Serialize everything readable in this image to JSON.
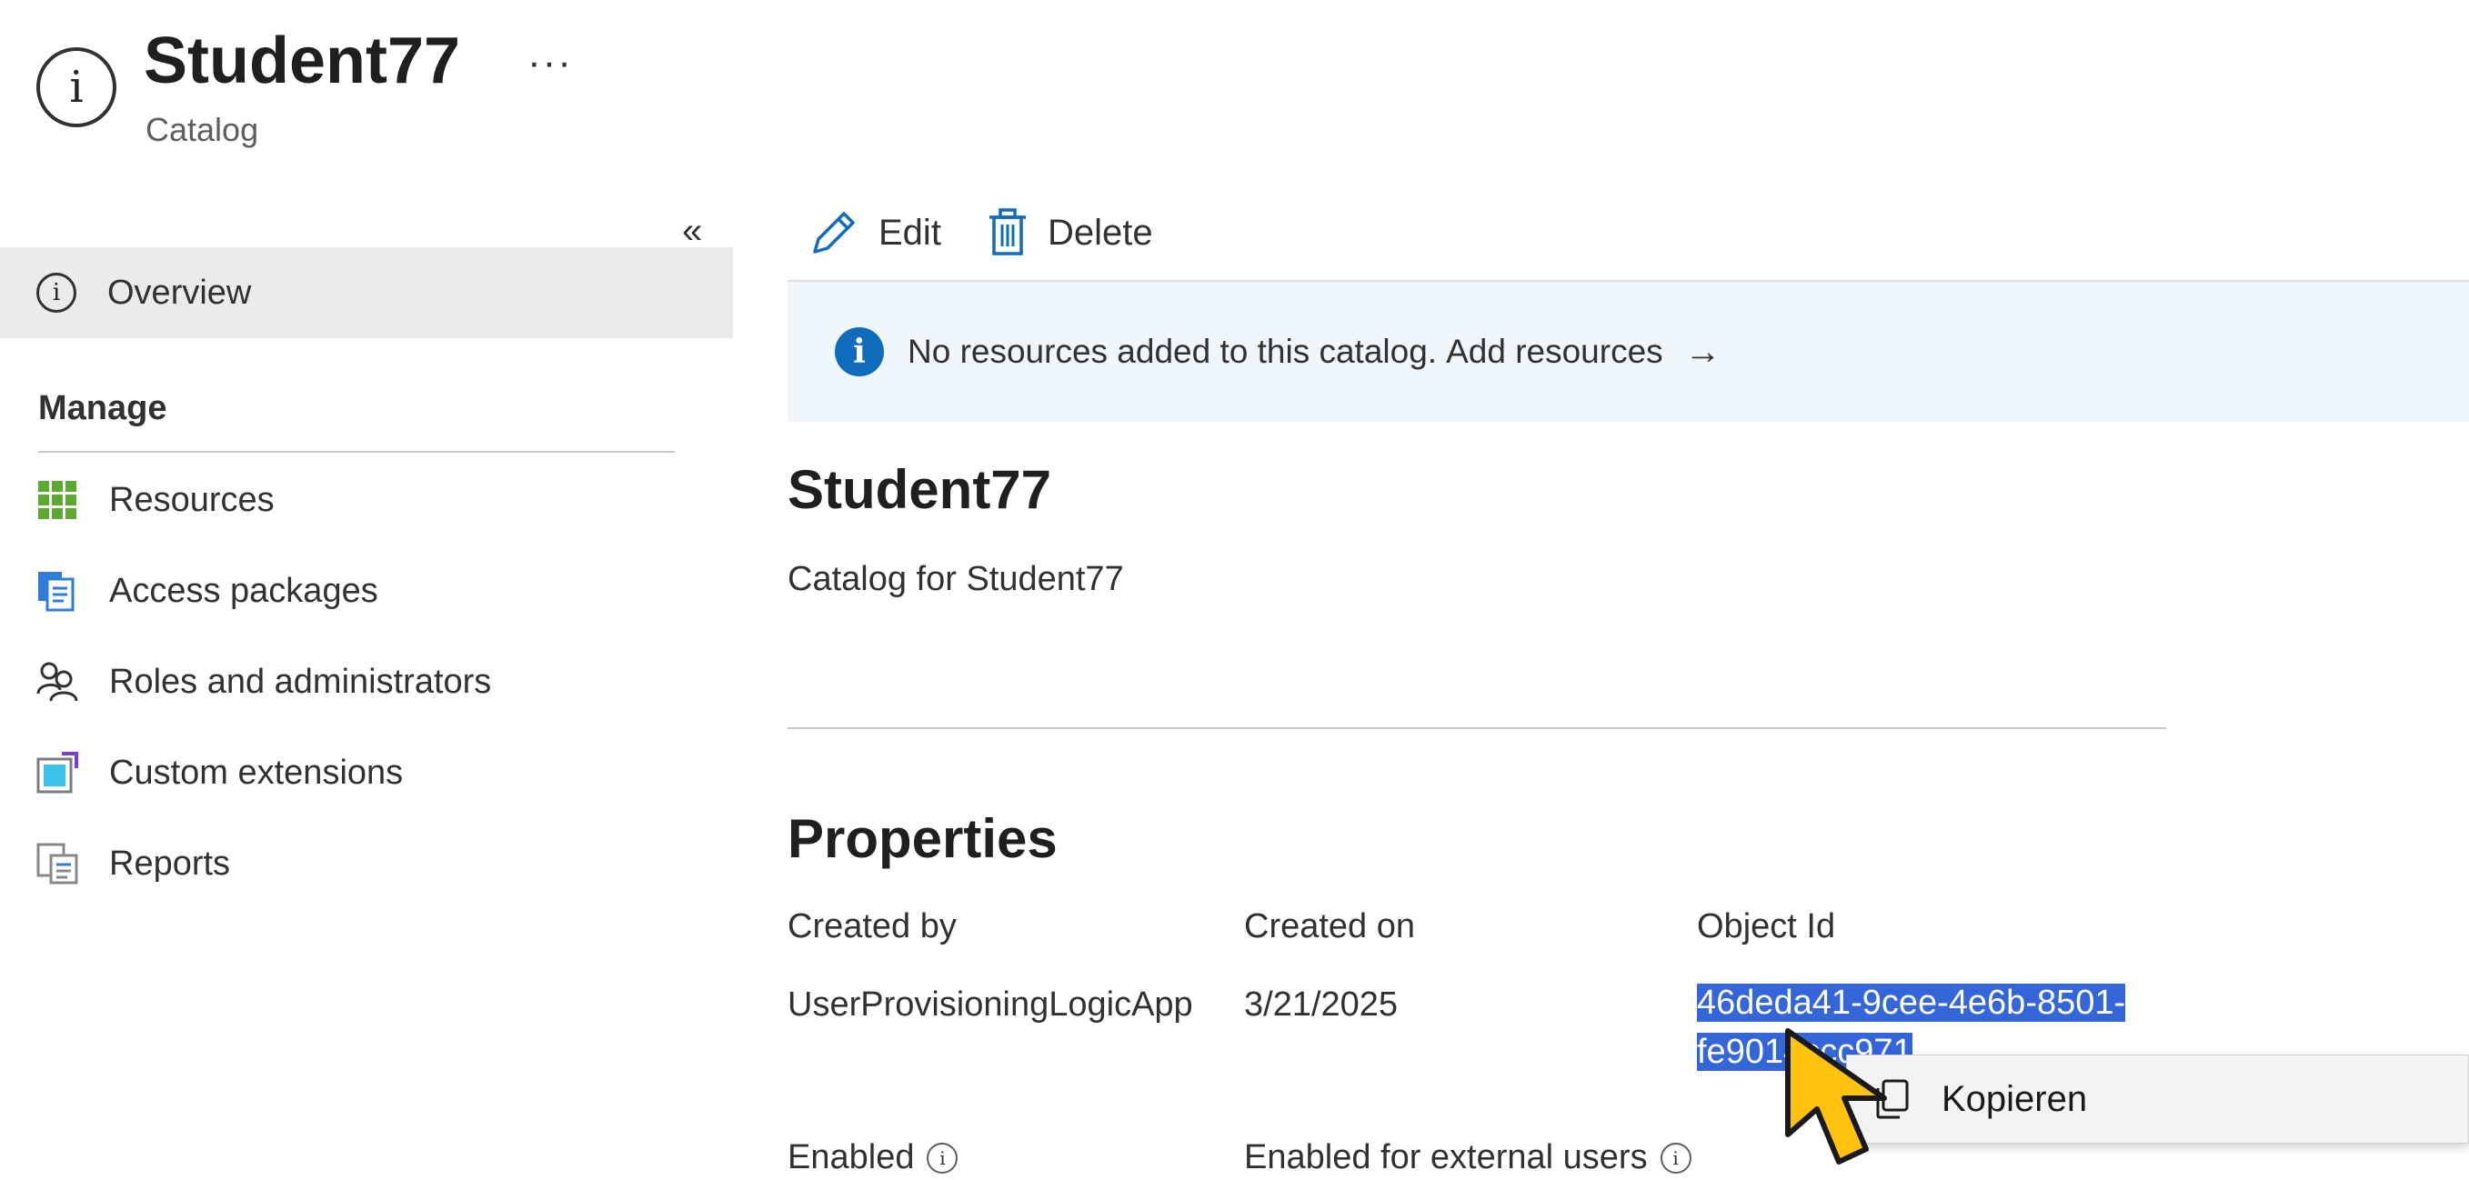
{
  "header": {
    "title": "Student77",
    "subtitle": "Catalog",
    "more_label": "···"
  },
  "sidebar": {
    "collapse_glyph": "«",
    "overview_label": "Overview",
    "section_label": "Manage",
    "items": [
      {
        "label": "Resources",
        "icon": "grid-icon"
      },
      {
        "label": "Access packages",
        "icon": "document-stack-icon"
      },
      {
        "label": "Roles and administrators",
        "icon": "people-icon"
      },
      {
        "label": "Custom extensions",
        "icon": "extension-icon"
      },
      {
        "label": "Reports",
        "icon": "report-icon"
      }
    ]
  },
  "toolbar": {
    "edit_label": "Edit",
    "delete_label": "Delete"
  },
  "banner": {
    "message": "No resources added to this catalog.",
    "link": "Add resources",
    "arrow": "→"
  },
  "main": {
    "title": "Student77",
    "description": "Catalog for Student77",
    "properties_title": "Properties",
    "columns": {
      "created_by_label": "Created by",
      "created_by_value": "UserProvisioningLogicApp",
      "created_on_label": "Created on",
      "created_on_value": "3/21/2025",
      "object_id_label": "Object Id",
      "object_id_line1": "46deda41-9cee-4e6b-8501-",
      "object_id_line2": "fe9014ccc971"
    },
    "enabled_label": "Enabled",
    "enabled_external_label": "Enabled for external users"
  },
  "context_menu": {
    "copy_label": "Kopieren"
  },
  "colors": {
    "accent": "#0f6cbd",
    "selection": "#3465d9",
    "banner_bg": "#eff6fc",
    "cursor": "#ffc20e"
  }
}
